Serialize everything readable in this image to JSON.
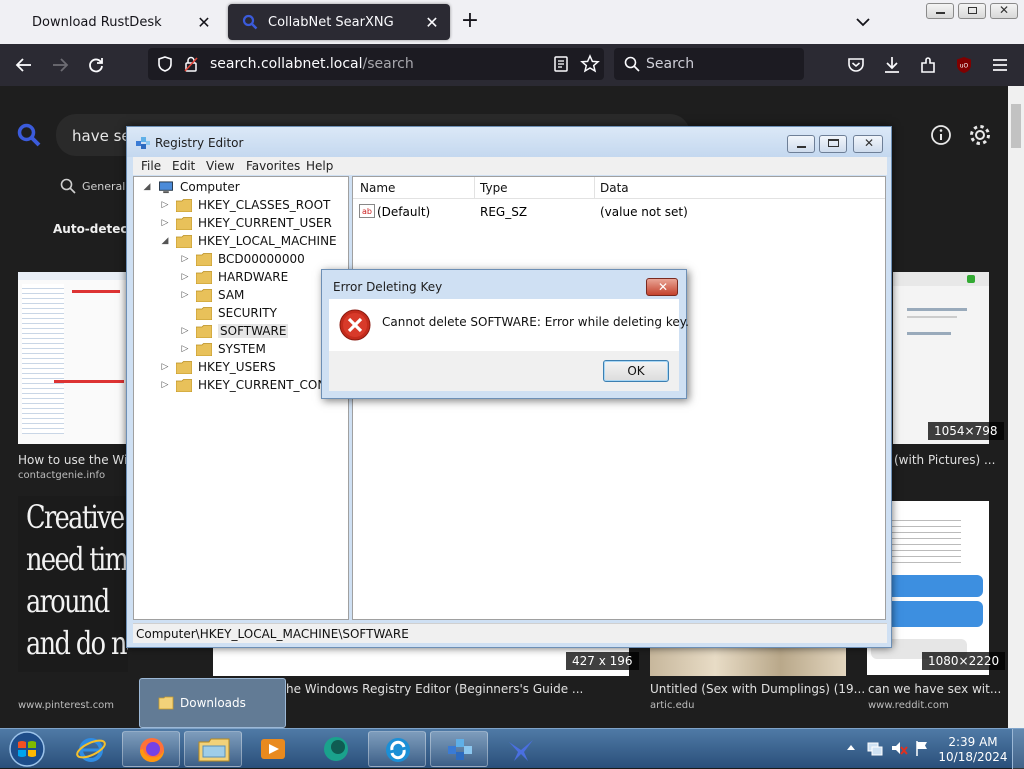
{
  "browser": {
    "tabs": [
      {
        "title": "Download RustDesk",
        "active": false
      },
      {
        "title": "CollabNet SearXNG",
        "active": true
      }
    ],
    "url_domain": "search.collabnet.local",
    "url_path": "/search",
    "search_placeholder": "Search"
  },
  "searx": {
    "query": "have sex",
    "tab_general": "General",
    "autodetect": "Auto-detect"
  },
  "results": [
    {
      "caption": "How to use the Wi",
      "site": "contactgenie.info"
    },
    {
      "caption": "(with Pictures) ...",
      "site": "",
      "dims": "1054×798"
    },
    {
      "caption": "he Windows Registry Editor (Beginners's Guide ...",
      "site": "",
      "dims": "427 x 196"
    },
    {
      "caption": "Untitled (Sex with Dumplings) (19...",
      "site": "artic.edu"
    },
    {
      "caption": "can we have sex wit...",
      "site": "www.reddit.com",
      "dims": "1080×2220"
    },
    {
      "caption": "",
      "site": "www.pinterest.com"
    }
  ],
  "poster_text": [
    "Creative p",
    "need time",
    "around",
    "and do nothing"
  ],
  "regedit": {
    "title": "Registry Editor",
    "menu": [
      "File",
      "Edit",
      "View",
      "Favorites",
      "Help"
    ],
    "tree": [
      {
        "label": "Computer",
        "level": 0
      },
      {
        "label": "HKEY_CLASSES_ROOT",
        "level": 1
      },
      {
        "label": "HKEY_CURRENT_USER",
        "level": 1
      },
      {
        "label": "HKEY_LOCAL_MACHINE",
        "level": 1
      },
      {
        "label": "BCD00000000",
        "level": 2
      },
      {
        "label": "HARDWARE",
        "level": 2
      },
      {
        "label": "SAM",
        "level": 2
      },
      {
        "label": "SECURITY",
        "level": 2
      },
      {
        "label": "SOFTWARE",
        "level": 2
      },
      {
        "label": "SYSTEM",
        "level": 2
      },
      {
        "label": "HKEY_USERS",
        "level": 1
      },
      {
        "label": "HKEY_CURRENT_CONF",
        "level": 1
      }
    ],
    "columns": [
      "Name",
      "Type",
      "Data"
    ],
    "values": [
      {
        "name": "(Default)",
        "type": "REG_SZ",
        "data": "(value not set)"
      }
    ],
    "status": "Computer\\HKEY_LOCAL_MACHINE\\SOFTWARE"
  },
  "dialog": {
    "title": "Error Deleting Key",
    "message": "Cannot delete SOFTWARE:  Error while deleting key.",
    "ok_label": "OK"
  },
  "taskbar": {
    "downloads_label": "Downloads",
    "time": "2:39 AM",
    "date": "10/18/2024"
  },
  "colors": {
    "accent_blue": "#3b5bdb",
    "error_red": "#c42b1c"
  }
}
